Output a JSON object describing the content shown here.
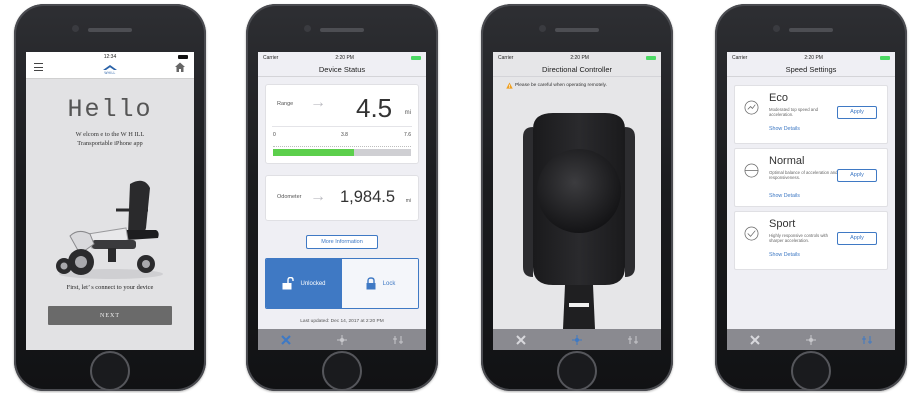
{
  "phone1": {
    "status_time": "12:34",
    "logo_word": "WHILL",
    "hello": "Hello",
    "welcome_line1": "W elcom e to the W H ILL",
    "welcome_line2": "Transportable iPhone app",
    "connect_text": "First, let’ s connect to your device",
    "next_label": "NEXT"
  },
  "phone2": {
    "carrier": "Carrier",
    "time": "2:20 PM",
    "title": "Device Status",
    "range_label": "Range",
    "range_value": "4.5",
    "range_unit": "mi",
    "ticks": [
      "0",
      "3.8",
      "7.6"
    ],
    "range_fill_fraction": 0.59,
    "odometer_label": "Odometer",
    "odometer_value": "1,984.5",
    "odometer_unit": "mi",
    "more_info": "More Information",
    "unlocked_label": "Unlocked",
    "lock_label": "Lock",
    "last_updated": "Last updated: Dec 14, 2017 at 2:20 PM"
  },
  "phone3": {
    "carrier": "Carrier",
    "time": "2:20 PM",
    "title": "Directional Controller",
    "warning": "Please be careful when operating remotely."
  },
  "phone4": {
    "carrier": "Carrier",
    "time": "2:20 PM",
    "title": "Speed Settings",
    "modes": [
      {
        "name": "Eco",
        "desc": "Moderated top speed and acceleration.",
        "link": "Show Details",
        "apply": "Apply"
      },
      {
        "name": "Normal",
        "desc": "Optimal balance of acceleration and responsiveness.",
        "link": "Show Details",
        "apply": "Apply"
      },
      {
        "name": "Sport",
        "desc": "Highly responsive controls with sharper acceleration.",
        "link": "Show Details",
        "apply": "Apply"
      }
    ]
  },
  "colors": {
    "accent_blue": "#3f79c4",
    "range_green": "#5ccf4c",
    "tabbar_gray": "#8a8a90",
    "next_button_gray": "#6a6a6a"
  },
  "icons": [
    "menu-icon",
    "whill-logo-icon",
    "home-icon",
    "lock-open-icon",
    "lock-closed-icon",
    "wheelchair-tab-icon",
    "controller-tab-icon",
    "speed-tab-icon",
    "warning-icon",
    "speedometer-icon"
  ]
}
